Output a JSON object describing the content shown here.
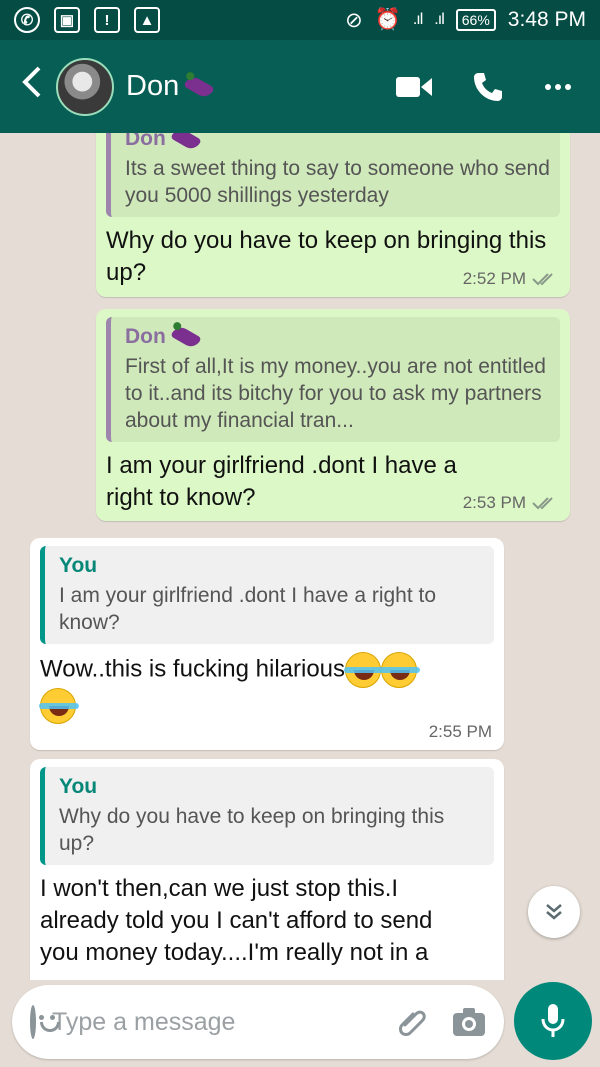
{
  "status_bar": {
    "battery": "66%",
    "time": "3:48 PM"
  },
  "header": {
    "back_icon": "chevron-left-icon",
    "contact_name": "Don",
    "video_icon": "video-camera-icon",
    "call_icon": "phone-icon",
    "menu_icon": "more-dots-icon",
    "colors": {
      "header_bg": "#075e54",
      "status_bg": "#054d44"
    }
  },
  "messages": [
    {
      "direction": "out",
      "quote_author": "Don",
      "quote_text": "Its a sweet thing to say to someone who send you 5000 shillings yesterday",
      "text": "Why do you have to keep on bringing this up?",
      "time": "2:52 PM"
    },
    {
      "direction": "out",
      "quote_author": "Don",
      "quote_text": "First of all,It is my money..you are not entitled to it..and its bitchy for you to ask my partners about my financial tran...",
      "text": "I am your girlfriend .dont I have a right to know?",
      "time": "2:53 PM"
    },
    {
      "direction": "in",
      "quote_author": "You",
      "quote_text": "I am your girlfriend .dont I have a right to know?",
      "text": "Wow..this is fucking hilarious",
      "time": "2:55 PM"
    },
    {
      "direction": "in",
      "quote_author": "You",
      "quote_text": "Why do you have to keep on bringing this up?",
      "text": "I won't then,can we just stop this.I already told you I can't afford to send you money today....I'm really not in a",
      "time": ""
    }
  ],
  "input": {
    "placeholder": "Type a message"
  },
  "colors": {
    "outgoing_bubble": "#dcf8c6",
    "incoming_bubble": "#ffffff",
    "accent": "#00897b"
  }
}
